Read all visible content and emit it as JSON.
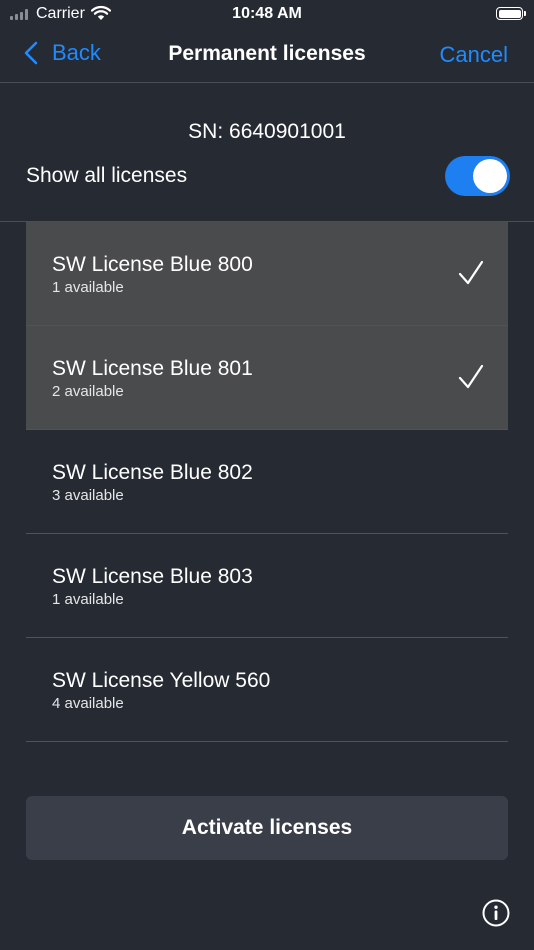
{
  "status_bar": {
    "carrier": "Carrier",
    "time": "10:48 AM",
    "icons": [
      "signal-icon",
      "wifi-icon",
      "battery-icon"
    ]
  },
  "nav": {
    "back_label": "Back",
    "title": "Permanent licenses",
    "cancel_label": "Cancel",
    "back_icon": "chevron-left-icon"
  },
  "header": {
    "sn_text": "SN:  6640901001",
    "show_all_label": "Show all licenses",
    "show_all_enabled": true
  },
  "licenses": [
    {
      "name": "SW License Blue 800",
      "available": "1 available",
      "selected": true
    },
    {
      "name": "SW License Blue 801",
      "available": "2 available",
      "selected": true
    },
    {
      "name": "SW License Blue 802",
      "available": "3 available",
      "selected": false
    },
    {
      "name": "SW License Blue 803",
      "available": "1 available",
      "selected": false
    },
    {
      "name": "SW License Yellow 560",
      "available": "4 available",
      "selected": false
    }
  ],
  "activate_label": "Activate licenses",
  "info_icon": "info-icon",
  "colors": {
    "background": "#262a33",
    "accent": "#1f8bff",
    "toggle_on": "#1e7ff0",
    "selected_row": "#4a4b4d",
    "button": "#3a3e48"
  }
}
